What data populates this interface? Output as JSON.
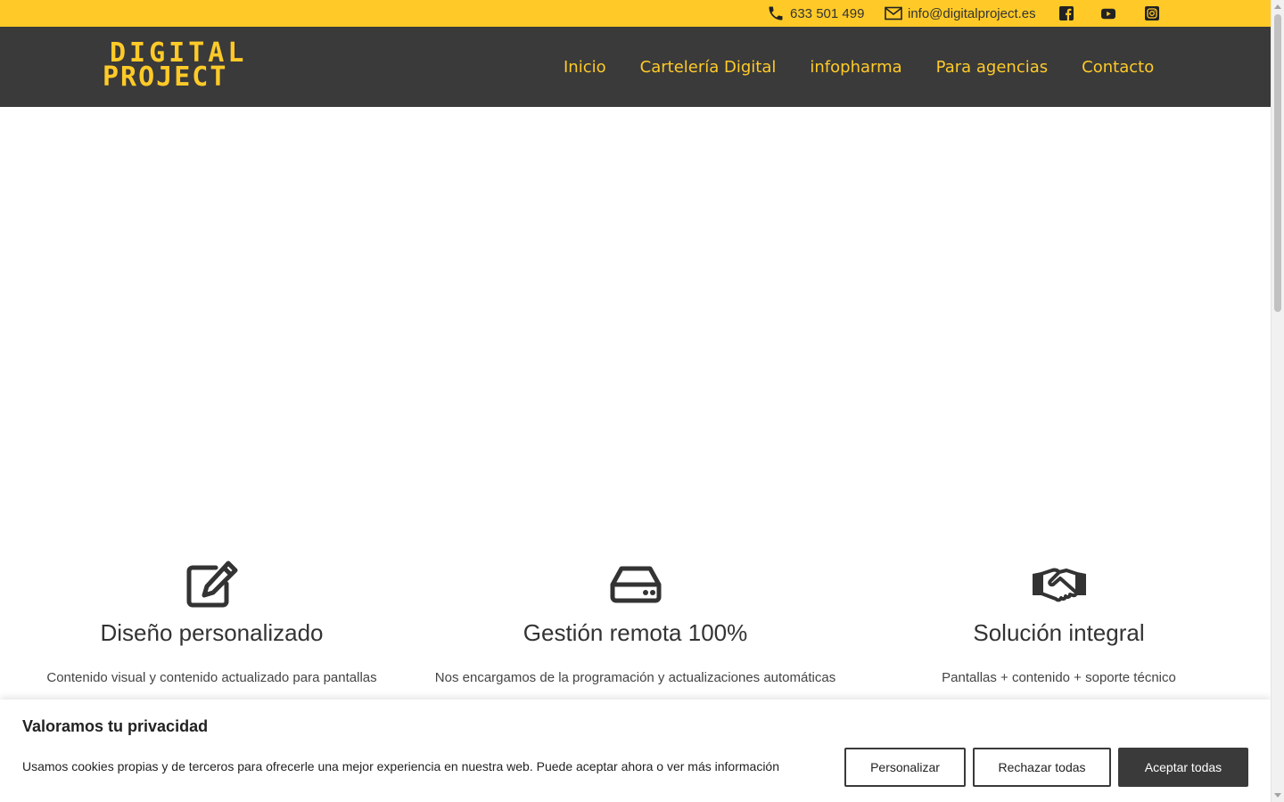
{
  "topbar": {
    "phone": "633 501 499",
    "email": "info@digitalproject.es",
    "social": [
      "facebook-icon",
      "youtube-icon",
      "instagram-icon"
    ],
    "background": "#ffca28"
  },
  "header": {
    "logo_line1": "DIGITAL",
    "logo_line2": "PROJECT",
    "nav": [
      {
        "label": "Inicio"
      },
      {
        "label": "Cartelería Digital"
      },
      {
        "label": "infopharma"
      },
      {
        "label": "Para agencias"
      },
      {
        "label": "Contacto"
      }
    ],
    "background": "#3a3a3a",
    "accent": "#ffca28"
  },
  "features": [
    {
      "icon": "edit-icon",
      "title": "Diseño personalizado",
      "desc": "Contenido visual y contenido actualizado para pantallas"
    },
    {
      "icon": "hard-drive-icon",
      "title": "Gestión remota 100%",
      "desc": "Nos encargamos de la programación y actualizaciones automáticas"
    },
    {
      "icon": "handshake-icon",
      "title": "Solución integral",
      "desc": "Pantallas + contenido + soporte técnico"
    }
  ],
  "cookie": {
    "title": "Valoramos tu privacidad",
    "text": "Usamos cookies propias y de terceros para ofrecerle una mejor experiencia en nuestra web. Puede aceptar ahora o ver más información",
    "buttons": {
      "customize": "Personalizar",
      "reject": "Rechazar todas",
      "accept": "Aceptar todas"
    }
  }
}
